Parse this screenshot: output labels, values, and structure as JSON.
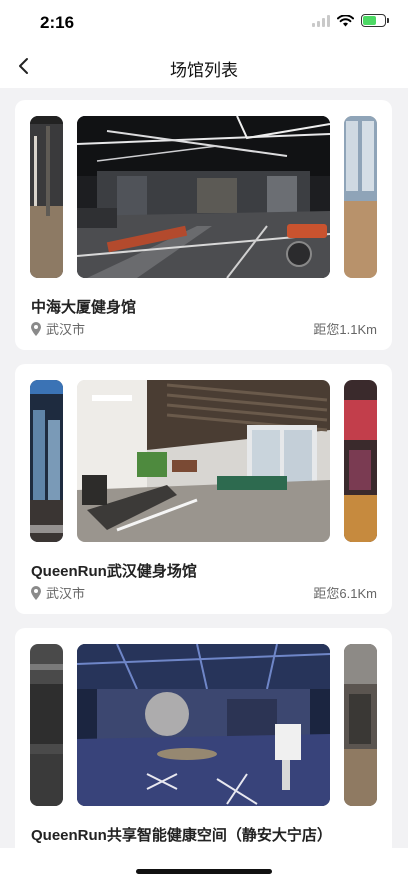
{
  "status_bar": {
    "time": "2:16"
  },
  "nav": {
    "title": "场馆列表",
    "back_icon": "chevron-left-icon"
  },
  "venues": [
    {
      "name": "中海大厦健身馆",
      "city": "武汉市",
      "distance": "距您1.1Km"
    },
    {
      "name": "QueenRun武汉健身场馆",
      "city": "武汉市",
      "distance": "距您6.1Km"
    },
    {
      "name": "QueenRun共享智能健康空间（静安大宁店）"
    }
  ],
  "colors": {
    "accent_battery": "#4cd964",
    "page_bg": "#f2f2f4"
  }
}
